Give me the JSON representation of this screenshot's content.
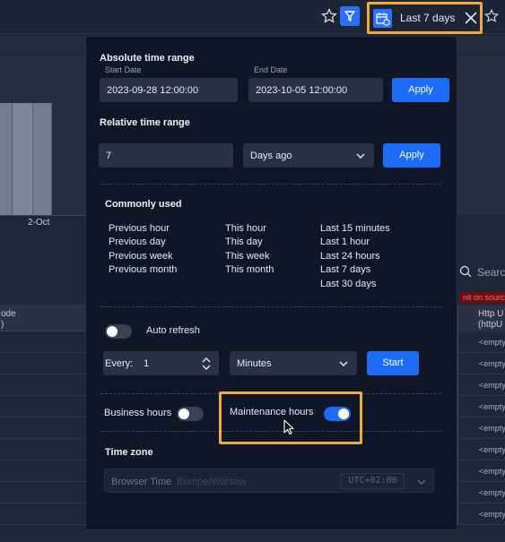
{
  "topbar": {
    "range_label": "Last 7 days"
  },
  "background": {
    "x_tick": "2-Oct",
    "search_placeholder": "Searc",
    "warning": "nit on source",
    "left_header": [
      "ode",
      ")"
    ],
    "right_header": [
      "Http U",
      "(httpU"
    ],
    "empty_value": "<empty"
  },
  "absolute": {
    "title": "Absolute time range",
    "start_label": "Start Date",
    "start_value": "2023-09-28 12:00:00",
    "end_label": "End Date",
    "end_value": "2023-10-05 12:00:00",
    "apply": "Apply"
  },
  "relative": {
    "title": "Relative time range",
    "amount": "7",
    "unit": "Days ago",
    "apply": "Apply"
  },
  "common": {
    "title": "Commonly used",
    "col1": [
      "Previous hour",
      "Previous day",
      "Previous week",
      "Previous month"
    ],
    "col2": [
      "This hour",
      "This day",
      "This week",
      "This month"
    ],
    "col3": [
      "Last 15 minutes",
      "Last 1 hour",
      "Last 24 hours",
      "Last 7 days",
      "Last 30 days"
    ]
  },
  "refresh": {
    "label": "Auto refresh",
    "enabled": false,
    "every_label": "Every:",
    "every_value": "1",
    "unit": "Minutes",
    "start": "Start"
  },
  "hours": {
    "business_label": "Business hours",
    "business_enabled": false,
    "maintenance_label": "Maintenance hours",
    "maintenance_enabled": true
  },
  "timezone": {
    "title": "Time zone",
    "value": "Browser Time",
    "zone": "Europe/Warsaw",
    "offset": "UTC+02:00"
  },
  "colors": {
    "accent": "#1d6cf6",
    "highlight": "#f2a93b",
    "popup_bg": "#111627"
  }
}
